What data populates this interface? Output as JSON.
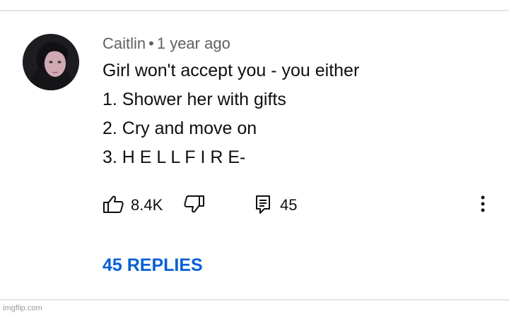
{
  "comment": {
    "author": "Caitlin",
    "separator": "•",
    "timestamp": "1 year ago",
    "lines": [
      "Girl won't accept you - you either",
      "1. Shower her with gifts",
      "2. Cry and move on",
      "3. H E L L F I R E-"
    ],
    "avatar_icon": "profile-photo"
  },
  "actions": {
    "like_icon": "thumbs-up-icon",
    "like_count": "8.4K",
    "dislike_icon": "thumbs-down-icon",
    "reply_icon": "comment-icon",
    "reply_count": "45",
    "menu_icon": "more-vertical-icon"
  },
  "replies_label": "45 REPLIES",
  "watermark": "imgflip.com",
  "colors": {
    "link": "#065fd4",
    "text": "#0f0f0f",
    "meta": "#606060"
  }
}
